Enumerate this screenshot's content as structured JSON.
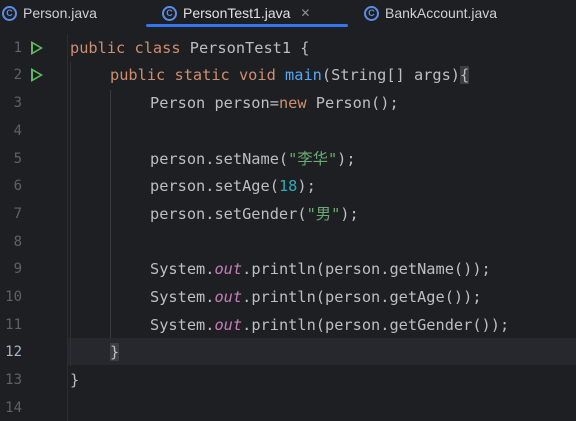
{
  "tabs": [
    {
      "label": "Person.java",
      "active": false
    },
    {
      "label": "PersonTest1.java",
      "active": true
    },
    {
      "label": "BankAccount.java",
      "active": false
    }
  ],
  "current_line": 12,
  "line_numbers": [
    "1",
    "2",
    "3",
    "4",
    "5",
    "6",
    "7",
    "8",
    "9",
    "10",
    "11",
    "12",
    "13",
    "14"
  ],
  "code": {
    "l1": {
      "kw1": "public",
      "kw2": "class",
      "name": "PersonTest1",
      "brace": "{"
    },
    "l2": {
      "kw1": "public",
      "kw2": "static",
      "kw3": "void",
      "fn": "main",
      "params": "(String[] args)",
      "brace": "{"
    },
    "l3": {
      "a": "Person person=",
      "kw": "new",
      "b": "Person();"
    },
    "l5": {
      "a": "person.setName(",
      "s": "\"李华\"",
      "b": ");"
    },
    "l6": {
      "a": "person.setAge(",
      "n": "18",
      "b": ");"
    },
    "l7": {
      "a": "person.setGender(",
      "s": "\"男\"",
      "b": ");"
    },
    "l9": {
      "a": "System.",
      "f": "out",
      "b": ".println(person.getName());"
    },
    "l10": {
      "a": "System.",
      "f": "out",
      "b": ".println(person.getAge());"
    },
    "l11": {
      "a": "System.",
      "f": "out",
      "b": ".println(person.getGender());"
    },
    "l12": {
      "brace": "}"
    },
    "l13": {
      "brace": "}"
    }
  }
}
